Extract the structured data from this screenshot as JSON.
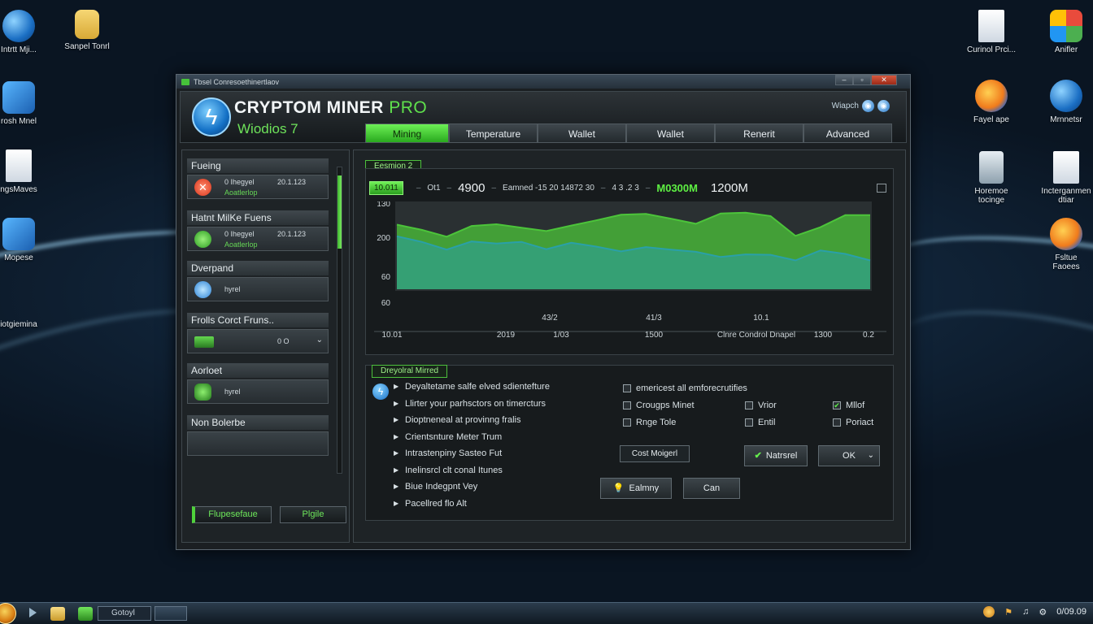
{
  "desktop": {
    "icons_left": [
      {
        "label": "Intrtt Mji...",
        "icon": "globe-icon"
      },
      {
        "label": "Sanpel Tonrl",
        "icon": "folder-icon"
      },
      {
        "label": "rosh Mnel",
        "icon": "app-icon"
      },
      {
        "label": "ngsMaves",
        "icon": "document-icon"
      },
      {
        "label": "Mopese",
        "icon": "app-icon"
      },
      {
        "label": "iotgiemina",
        "icon": "app-icon"
      }
    ],
    "icons_right": [
      {
        "label": "Curinol Prci...",
        "icon": "document-icon"
      },
      {
        "label": "Anifler",
        "icon": "multicolor-app-icon"
      },
      {
        "label": "Fayel ape",
        "icon": "firefox-icon"
      },
      {
        "label": "Mrnnetsr",
        "icon": "ie-icon"
      },
      {
        "label": "Horemoe\ntocinge",
        "icon": "recycle-bin-icon"
      },
      {
        "label": "Incterganmen\ndtiar",
        "icon": "document-icon"
      },
      {
        "label": "Fsltue\nFaoees",
        "icon": "firefox-icon"
      }
    ]
  },
  "window": {
    "title": "Tbsel Conresoethinertlaov",
    "controls": {
      "minimize": "–",
      "maximize": "▫",
      "close": "✕"
    }
  },
  "header": {
    "app_name": "CRYPTOM MINER",
    "app_name_suffix": "PRO",
    "subtitle": "Wiodios 7",
    "right_label": "Wiapch",
    "tabs": [
      "Mining",
      "Temperature",
      "Wallet",
      "Wallet",
      "Renerit",
      "Advanced"
    ],
    "active_tab": "Mining"
  },
  "sidebar": {
    "groups": [
      {
        "title": "Fueing",
        "item": {
          "icon": "error-icon",
          "line1": "0 Ihegyel",
          "line2": "Aoatlerlop",
          "line3": "20.1.123"
        }
      },
      {
        "title": "Hatnt MilKe Fuens",
        "item": {
          "icon": "green-status-icon",
          "line1": "0 Ihegyel",
          "line2": "Aoatlerlop",
          "line3": "20.1.123"
        }
      },
      {
        "title": "Dverpand",
        "item": {
          "icon": "blue-status-icon",
          "line1": "hyrel",
          "line2": "",
          "line3": ""
        }
      },
      {
        "title": "Frolls Corct Fruns..",
        "item": {
          "icon": "gpu-chip-icon",
          "line1": "",
          "line2": "",
          "line3": "0 O"
        }
      },
      {
        "title": "Aorloet",
        "item": {
          "icon": "shield-icon",
          "line1": "hyrel",
          "line2": "",
          "line3": ""
        }
      },
      {
        "title": "Non Bolerbe",
        "item": {
          "icon": "",
          "line1": "",
          "line2": "",
          "line3": ""
        }
      }
    ],
    "buttons": {
      "purchase": "Flupesefaue",
      "profile": "Plgile"
    },
    "scroll_fraction": 0.25
  },
  "mining_panel": {
    "section_label": "Eesmion 2",
    "stats": {
      "badge": "10.011",
      "v1": "Ot1",
      "v2": "4900",
      "v3": "Eamned -15 20 14872 30",
      "v4": "4 3 .2 3",
      "v5": "M0300M",
      "v6": "1200M"
    }
  },
  "chart_data": {
    "type": "area",
    "y_tick_labels": [
      "130",
      "200",
      "60",
      "60"
    ],
    "x_tick_labels_upper": [
      "43/2",
      "41/3",
      "10.1"
    ],
    "x_tick_labels_lower": [
      "10.01",
      "2019",
      "1/03",
      "1500",
      "Clnre Condrol Dnapel",
      "1300",
      "0.2"
    ],
    "series": [
      {
        "color": "#4cc43a",
        "values": [
          150,
          138,
          122,
          147,
          151,
          143,
          135,
          148,
          160,
          173,
          175,
          164,
          152,
          176,
          178,
          170,
          124,
          144,
          172,
          172
        ]
      },
      {
        "color": "#2aa0a8",
        "values": [
          123,
          110,
          92,
          111,
          106,
          110,
          93,
          108,
          99,
          88,
          98,
          92,
          87,
          75,
          81,
          80,
          67,
          90,
          82,
          67
        ]
      }
    ],
    "ylim": [
      0,
      200
    ],
    "grid": false
  },
  "options_panel": {
    "section_label": "Dreyolral Mirred",
    "list": [
      "Deyaltetame salfe elved sdientefture",
      "Llirter your parhsctors on timercturs",
      "Dioptneneal at provinng fralis",
      "Crientsnture Meter Trum",
      "Intrastenpiny Sasteo Fut",
      "Inelinsrcl clt conal Itunes",
      "Biue Indegpnt Vey",
      "Pacellred flo Alt"
    ],
    "checkboxes": [
      {
        "label": "emericest all emforecrutifies",
        "checked": false
      },
      {
        "label": "Crougps Minet",
        "checked": false
      },
      {
        "label": "Vrior",
        "checked": false
      },
      {
        "label": "Mllof",
        "checked": true
      },
      {
        "label": "Rnge Tole",
        "checked": false
      },
      {
        "label": "Entil",
        "checked": false
      },
      {
        "label": "Poriact",
        "checked": false
      }
    ],
    "buttons": {
      "cost": "Cost Moigerl",
      "natural": "Natrsrel",
      "ok": "OK",
      "entry": "Ealmny",
      "cancel": "Can"
    }
  },
  "taskbar": {
    "search_text": "Gotoyl",
    "clock": "0/09.09"
  }
}
